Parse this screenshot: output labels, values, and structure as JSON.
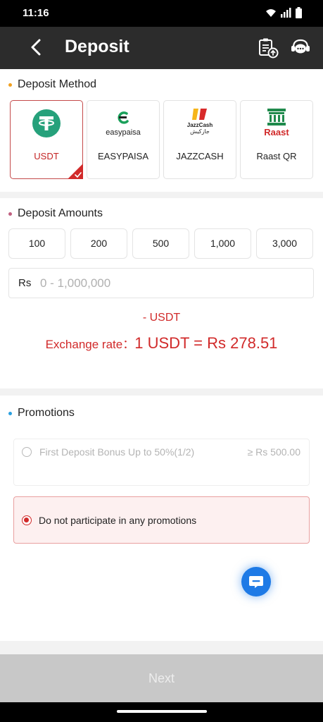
{
  "status_bar": {
    "time": "11:16"
  },
  "header": {
    "title": "Deposit"
  },
  "deposit_method": {
    "title": "Deposit Method",
    "dot_color": "#f0a020",
    "methods": [
      {
        "label": "USDT",
        "selected": true
      },
      {
        "label": "EASYPAISA",
        "selected": false,
        "logo_text": "easypaisa"
      },
      {
        "label": "JAZZCASH",
        "selected": false,
        "logo_text": "JazzCash",
        "logo_subtext": "جازکیش"
      },
      {
        "label": "Raast QR",
        "selected": false,
        "logo_text": "Raast"
      }
    ]
  },
  "deposit_amounts": {
    "title": "Deposit Amounts",
    "dot_color": "#c06080",
    "quick_amounts": [
      "100",
      "200",
      "500",
      "1,000",
      "3,000"
    ],
    "currency_symbol": "Rs",
    "input_placeholder": "0 - 1,000,000",
    "converted": "- USDT",
    "exchange_label": "Exchange rate：",
    "exchange_value": "1 USDT = Rs 278.51"
  },
  "promotions": {
    "title": "Promotions",
    "dot_color": "#2aa0e0",
    "options": [
      {
        "label": "First Deposit Bonus Up to 50%(1/2)",
        "min": "≥ Rs 500.00",
        "disabled": true,
        "selected": false
      },
      {
        "label": "Do not participate in any promotions",
        "disabled": false,
        "selected": true
      }
    ]
  },
  "footer": {
    "next_label": "Next"
  },
  "colors": {
    "accent": "#d12a2a",
    "fab": "#1e7ae6",
    "usdt": "#26a17b"
  }
}
